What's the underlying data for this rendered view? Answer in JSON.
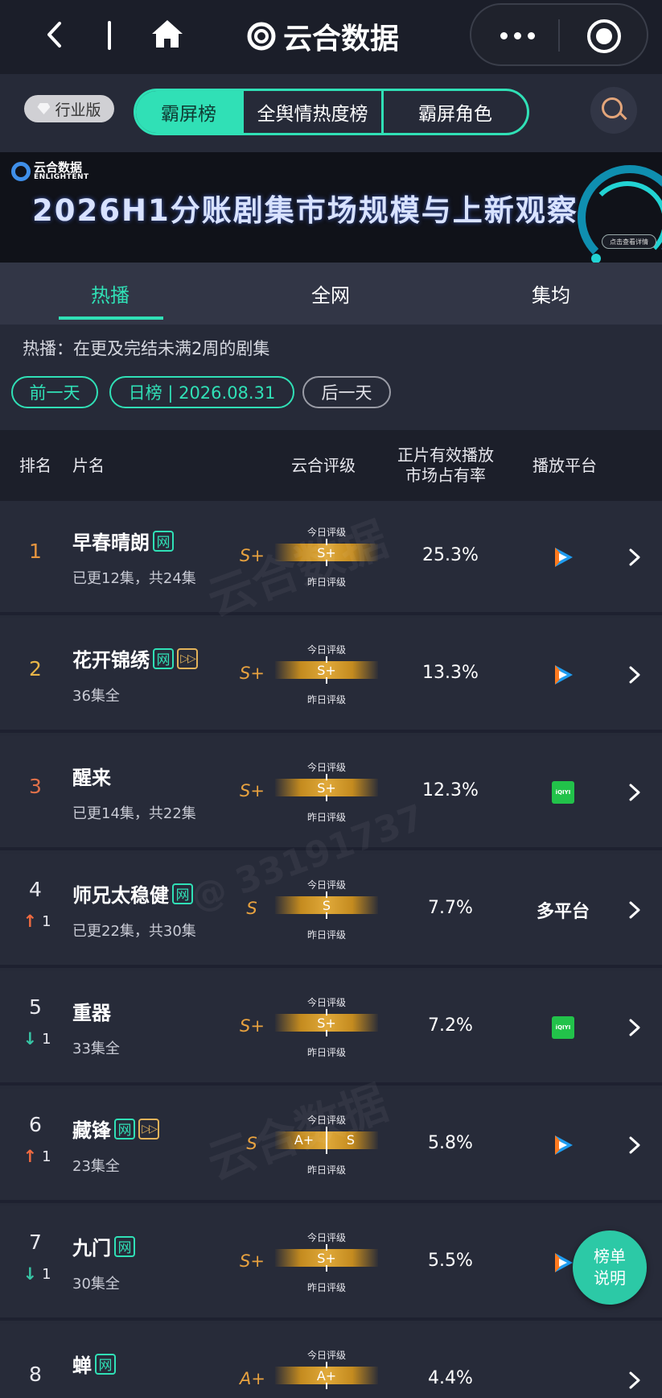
{
  "app": {
    "title": "云合数据"
  },
  "nav": {
    "edition": "行业版",
    "tabs": [
      "霸屏榜",
      "全舆情热度榜",
      "霸屏角色"
    ]
  },
  "banner": {
    "logo_cn": "云合数据",
    "logo_en": "ENLIGHTENT",
    "title": "2026H1分账剧集市场规模与上新观察",
    "cta": "点击查看详情"
  },
  "subtabs": [
    "热播",
    "全网",
    "集均"
  ],
  "description": "热播：在更及完结未满2周的剧集",
  "date_bar": {
    "prev": "前一天",
    "current": "日榜 | 2026.08.31",
    "next": "后一天"
  },
  "table": {
    "headers": {
      "rank": "排名",
      "name": "片名",
      "grade": "云合评级",
      "share": "正片有效播放\n市场占有率",
      "platform": "播放平台"
    },
    "grade_top": "今日评级",
    "grade_bottom": "昨日评级",
    "rows": [
      {
        "rank": "1",
        "name": "早春晴朗",
        "tags": [
          "网"
        ],
        "status": "已更12集，共24集",
        "grade": "S+",
        "today": "S+",
        "yesterday": "S+",
        "share": "25.3%",
        "platform": "tencent",
        "move": null
      },
      {
        "rank": "2",
        "name": "花开锦绣",
        "tags": [
          "网",
          "play"
        ],
        "status": "36集全",
        "grade": "S+",
        "today": "S+",
        "yesterday": "S+",
        "share": "13.3%",
        "platform": "tencent",
        "move": null
      },
      {
        "rank": "3",
        "name": "醒来",
        "tags": [],
        "status": "已更14集，共22集",
        "grade": "S+",
        "today": "S+",
        "yesterday": "S+",
        "share": "12.3%",
        "platform": "iqiyi",
        "move": null
      },
      {
        "rank": "4",
        "name": "师兄太稳健",
        "tags": [
          "网"
        ],
        "status": "已更22集，共30集",
        "grade": "S",
        "today": "S",
        "yesterday": "S",
        "share": "7.7%",
        "platform": "多平台",
        "move": {
          "dir": "up",
          "n": "1"
        }
      },
      {
        "rank": "5",
        "name": "重器",
        "tags": [],
        "status": "33集全",
        "grade": "S+",
        "today": "S+",
        "yesterday": "S+",
        "share": "7.2%",
        "platform": "iqiyi",
        "move": {
          "dir": "down",
          "n": "1"
        }
      },
      {
        "rank": "6",
        "name": "藏锋",
        "tags": [
          "网",
          "play"
        ],
        "status": "23集全",
        "grade": "S",
        "today": "S",
        "yesterday": "A+",
        "share": "5.8%",
        "platform": "tencent",
        "move": {
          "dir": "up",
          "n": "1"
        }
      },
      {
        "rank": "7",
        "name": "九门",
        "tags": [
          "网"
        ],
        "status": "30集全",
        "grade": "S+",
        "today": "S+",
        "yesterday": "S+",
        "share": "5.5%",
        "platform": "tencent",
        "move": {
          "dir": "down",
          "n": "1"
        }
      },
      {
        "rank": "8",
        "name": "蝉",
        "tags": [
          "网"
        ],
        "status": "",
        "grade": "A+",
        "today": "A+",
        "yesterday": "A+",
        "share": "4.4%",
        "platform": "",
        "move": null
      }
    ]
  },
  "platform_labels": {
    "iqiyi": "iQIYI"
  },
  "fab": {
    "line1": "榜单",
    "line2": "说明"
  },
  "colors": {
    "accent": "#30e0b6",
    "grade": "#e8a23f",
    "up": "#ef6a40",
    "down": "#37c6a5"
  },
  "watermark_id": "@ 33191737"
}
